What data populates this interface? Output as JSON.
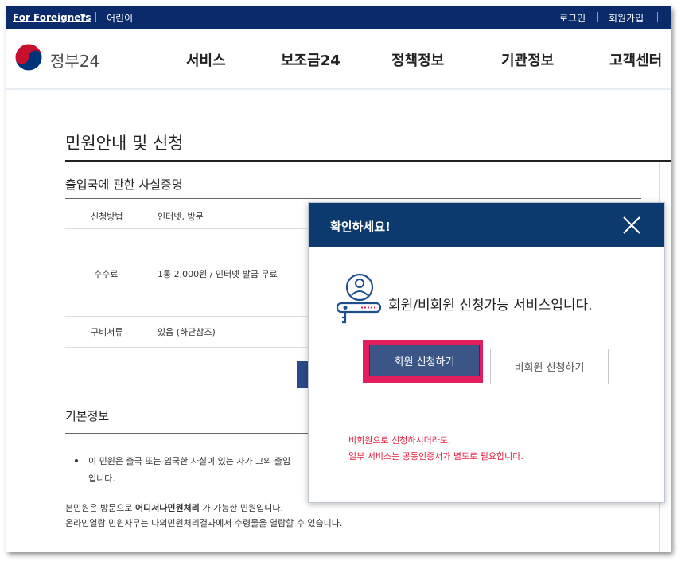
{
  "topbar": {
    "foreigners": "For Foreigners",
    "kids": "어린이",
    "login": "로그인",
    "signup": "회원가입"
  },
  "header": {
    "logo_text": "정부24",
    "nav": [
      "서비스",
      "보조금24",
      "정책정보",
      "기관정보",
      "고객센터"
    ]
  },
  "page": {
    "title": "민원안내 및 신청",
    "subtitle": "출입국에 관한 사실증명",
    "rows": [
      {
        "label": "신청방법",
        "value": "인터넷, 방문"
      },
      {
        "label": "수수료",
        "value": "1통 2,000원 / 인터넷 발급 무료"
      },
      {
        "label": "구비서류",
        "value": "있음 (하단참조)"
      }
    ],
    "basic_title": "기본정보",
    "basic_bullet_1": "이 민원은 출국 또는 입국한 사실이 있는 자가 그의 출입",
    "basic_bullet_2": "입니다.",
    "basic_line_3_pre": "본민원은 방문으로 ",
    "basic_line_3_bold": "어디서나민원처리",
    "basic_line_3_post": " 가 가능한 민원입니다.",
    "basic_line_4": "온라인열람 민원사무는 나의민원처리결과에서 수령물을 열람할 수 있습니다."
  },
  "modal": {
    "title": "확인하세요!",
    "message": "회원/비회원 신청가능 서비스입니다.",
    "member_button": "회원 신청하기",
    "nonmember_button": "비회원 신청하기",
    "notice_1": "비회원으로 신청하시더라도,",
    "notice_2": "일부 서비스는 공동인증서가 별도로 필요합니다."
  },
  "icons": {
    "close": "close-icon",
    "person": "person-id-icon",
    "logo": "taegeuk-logo-icon"
  },
  "colors": {
    "topbar": "#0a2a6a",
    "modal_header": "#0d3a6e",
    "member_button": "#3b5586",
    "highlight": "#e31e5c",
    "notice": "#e31e3c"
  }
}
